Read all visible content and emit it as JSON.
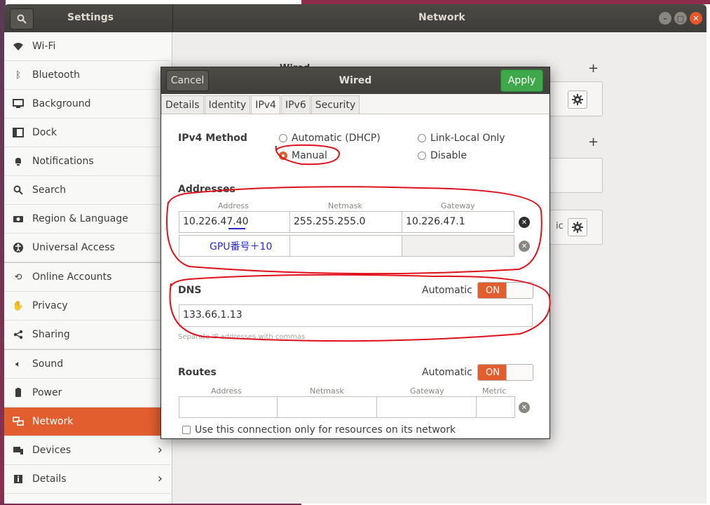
{
  "header": {
    "left_title": "Settings",
    "main_title": "Network",
    "window_controls": [
      "minimize",
      "maximize",
      "close"
    ]
  },
  "sidebar": {
    "items": [
      {
        "label": "Wi-Fi",
        "icon": "wifi-icon"
      },
      {
        "label": "Bluetooth",
        "icon": "bluetooth-icon"
      },
      {
        "label": "Background",
        "icon": "monitor-icon"
      },
      {
        "label": "Dock",
        "icon": "dock-icon"
      },
      {
        "label": "Notifications",
        "icon": "bell-icon"
      },
      {
        "label": "Search",
        "icon": "search-icon"
      },
      {
        "label": "Region & Language",
        "icon": "camera-icon"
      },
      {
        "label": "Universal Access",
        "icon": "accessibility-icon"
      },
      {
        "label": "Online Accounts",
        "icon": "accounts-icon"
      },
      {
        "label": "Privacy",
        "icon": "hand-icon"
      },
      {
        "label": "Sharing",
        "icon": "share-icon"
      },
      {
        "label": "Sound",
        "icon": "speaker-icon"
      },
      {
        "label": "Power",
        "icon": "power-icon"
      },
      {
        "label": "Network",
        "icon": "network-icon",
        "active": true
      },
      {
        "label": "Devices",
        "icon": "devices-icon",
        "has_chevron": true
      },
      {
        "label": "Details",
        "icon": "info-icon",
        "has_chevron": true
      }
    ]
  },
  "background_panel": {
    "wired_label": "Wired",
    "fragment_text": "ic"
  },
  "dialog": {
    "title": "Wired",
    "cancel_label": "Cancel",
    "apply_label": "Apply",
    "tabs": [
      "Details",
      "Identity",
      "IPv4",
      "IPv6",
      "Security"
    ],
    "active_tab": "IPv4",
    "ipv4_method": {
      "label": "IPv4 Method",
      "options": [
        "Automatic (DHCP)",
        "Link-Local Only",
        "Manual",
        "Disable"
      ],
      "selected": "Manual"
    },
    "addresses": {
      "label": "Addresses",
      "columns": [
        "Address",
        "Netmask",
        "Gateway"
      ],
      "rows": [
        {
          "address": "10.226.47.40",
          "netmask": "255.255.255.0",
          "gateway": "10.226.47.1"
        },
        {
          "address": "",
          "netmask": "",
          "gateway": ""
        }
      ]
    },
    "dns": {
      "label": "DNS",
      "automatic_label": "Automatic",
      "switch_state": "ON",
      "value": "133.66.1.13",
      "hint": "Separate IP addresses with commas"
    },
    "routes": {
      "label": "Routes",
      "automatic_label": "Automatic",
      "switch_state": "ON",
      "columns": [
        "Address",
        "Netmask",
        "Gateway",
        "Metric"
      ]
    },
    "only_resources_label": "Use this connection only for resources on its network"
  },
  "annotations": {
    "gpu_note": "GPU番号＋10",
    "stroke_color": "#e0101a",
    "note_color": "#2a2ad0"
  }
}
